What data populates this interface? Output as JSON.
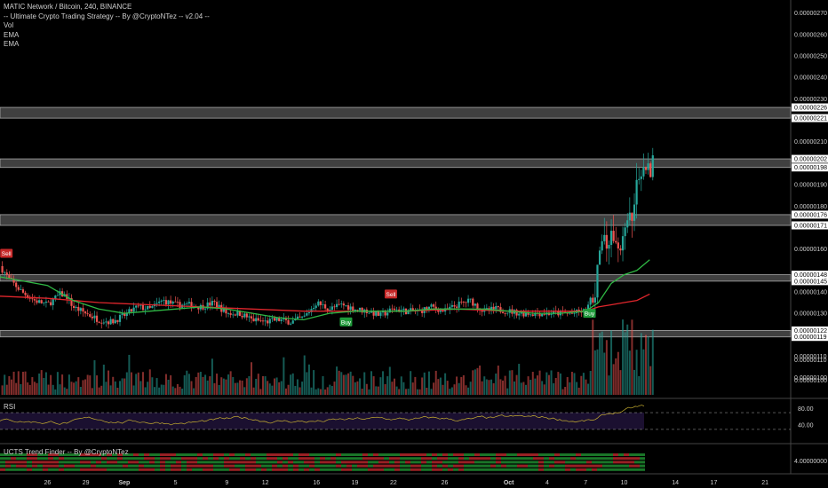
{
  "legend": {
    "symbol": "MATIC Network / Bitcoin, 240, BINANCE",
    "strategy": "-- Ultimate Crypto Trading Strategy -- By @CryptoNTez -- v2.04 --",
    "vol": "Vol",
    "ema1": "EMA",
    "ema2": "EMA"
  },
  "rsi_label": "RSI",
  "trend_label": "UCTS Trend Finder -- By @CryptoNTez",
  "colors": {
    "background": "#000000",
    "up": "#26a69a",
    "down": "#ef5350",
    "ema_fast": "#2fb844",
    "ema_slow": "#e0262c",
    "rsi_line": "#c8b030",
    "rsi_band": "#1b1030",
    "zone_fill": "#555555",
    "buy_label": "#1f9b3a",
    "sell_label": "#c62828"
  },
  "chart_data": {
    "type": "candlestick",
    "title": "MATIC Network / Bitcoin, 240, BINANCE",
    "price_ticks": [
      "0.00000270",
      "0.00000260",
      "0.00000250",
      "0.00000240",
      "0.00000230",
      "0.00000210",
      "0.00000190",
      "0.00000180",
      "0.00000160",
      "0.00000140",
      "0.00000130",
      "0.00000110",
      "0.00000100"
    ],
    "price_level_labels": [
      "0.00000226",
      "0.00000221",
      "0.00000202",
      "0.00000198",
      "0.00000176",
      "0.00000171",
      "0.00000148",
      "0.00000145",
      "0.00000122",
      "0.00000119"
    ],
    "y_range": [
      9.2e-07,
      2.74e-06
    ],
    "x_ticks": [
      "26",
      "29",
      "Sep",
      "5",
      "9",
      "12",
      "16",
      "19",
      "22",
      "26",
      "Oct",
      "4",
      "7",
      "10",
      "14",
      "17",
      "21"
    ],
    "x_tick_positions": [
      0,
      3,
      6,
      10,
      14,
      17,
      21,
      24,
      27,
      31,
      36,
      39,
      42,
      45,
      49,
      52,
      56
    ],
    "x_range": [
      -3.7,
      58
    ],
    "zones": [
      [
        2.21e-06,
        2.26e-06
      ],
      [
        1.98e-06,
        2.02e-06
      ],
      [
        1.71e-06,
        1.76e-06
      ],
      [
        1.45e-06,
        1.48e-06
      ],
      [
        1.19e-06,
        1.22e-06
      ]
    ],
    "close_path": [
      [
        -3.7,
        1.52
      ],
      [
        -3,
        1.46
      ],
      [
        -2,
        1.4
      ],
      [
        -1,
        1.36
      ],
      [
        0,
        1.34
      ],
      [
        1,
        1.39
      ],
      [
        1.5,
        1.38
      ],
      [
        2,
        1.33
      ],
      [
        3,
        1.3
      ],
      [
        4,
        1.27
      ],
      [
        5,
        1.26
      ],
      [
        6,
        1.29
      ],
      [
        7,
        1.33
      ],
      [
        8,
        1.32
      ],
      [
        9,
        1.36
      ],
      [
        10,
        1.34
      ],
      [
        11,
        1.34
      ],
      [
        12,
        1.33
      ],
      [
        13,
        1.35
      ],
      [
        14,
        1.3
      ],
      [
        15,
        1.3
      ],
      [
        16,
        1.27
      ],
      [
        17,
        1.26
      ],
      [
        18,
        1.27
      ],
      [
        19,
        1.26
      ],
      [
        20,
        1.28
      ],
      [
        21,
        1.35
      ],
      [
        22,
        1.32
      ],
      [
        23,
        1.34
      ],
      [
        24,
        1.32
      ],
      [
        25,
        1.31
      ],
      [
        26,
        1.29
      ],
      [
        27,
        1.32
      ],
      [
        28,
        1.31
      ],
      [
        29,
        1.31
      ],
      [
        30,
        1.33
      ],
      [
        31,
        1.31
      ],
      [
        32,
        1.34
      ],
      [
        33,
        1.36
      ],
      [
        34,
        1.31
      ],
      [
        35,
        1.32
      ],
      [
        36,
        1.31
      ],
      [
        37,
        1.3
      ],
      [
        38,
        1.3
      ],
      [
        39,
        1.3
      ],
      [
        40,
        1.3
      ],
      [
        41,
        1.3
      ],
      [
        42,
        1.31
      ],
      [
        42.7,
        1.4
      ],
      [
        43,
        1.56
      ],
      [
        43.5,
        1.62
      ],
      [
        44,
        1.66
      ],
      [
        44.5,
        1.6
      ],
      [
        45,
        1.66
      ],
      [
        45.5,
        1.74
      ],
      [
        46,
        1.88
      ],
      [
        46.5,
        2.03
      ],
      [
        47,
        1.96
      ],
      [
        47.3,
        2.04
      ]
    ],
    "ema_fast": [
      [
        -3.7,
        1.47
      ],
      [
        0,
        1.43
      ],
      [
        2,
        1.36
      ],
      [
        4,
        1.32
      ],
      [
        6,
        1.3
      ],
      [
        8,
        1.31
      ],
      [
        10,
        1.32
      ],
      [
        12,
        1.33
      ],
      [
        14,
        1.32
      ],
      [
        16,
        1.3
      ],
      [
        18,
        1.28
      ],
      [
        20,
        1.27
      ],
      [
        22,
        1.3
      ],
      [
        24,
        1.31
      ],
      [
        26,
        1.31
      ],
      [
        28,
        1.31
      ],
      [
        30,
        1.32
      ],
      [
        32,
        1.32
      ],
      [
        34,
        1.32
      ],
      [
        36,
        1.31
      ],
      [
        38,
        1.3
      ],
      [
        40,
        1.3
      ],
      [
        42,
        1.31
      ],
      [
        43,
        1.35
      ],
      [
        44,
        1.44
      ],
      [
        45,
        1.48
      ],
      [
        46,
        1.5
      ],
      [
        47,
        1.55
      ]
    ],
    "ema_slow": [
      [
        -3.7,
        1.38
      ],
      [
        0,
        1.37
      ],
      [
        4,
        1.35
      ],
      [
        8,
        1.34
      ],
      [
        12,
        1.33
      ],
      [
        16,
        1.32
      ],
      [
        20,
        1.31
      ],
      [
        24,
        1.31
      ],
      [
        28,
        1.31
      ],
      [
        32,
        1.32
      ],
      [
        36,
        1.31
      ],
      [
        40,
        1.31
      ],
      [
        42,
        1.31
      ],
      [
        43,
        1.33
      ],
      [
        44,
        1.34
      ],
      [
        45,
        1.35
      ],
      [
        46,
        1.36
      ],
      [
        47,
        1.39
      ]
    ],
    "signals": [
      {
        "label": "Sell",
        "x": -3.2,
        "price": 1.58,
        "type": "sell"
      },
      {
        "label": "Buy",
        "x": 23.3,
        "price": 1.26,
        "type": "buy"
      },
      {
        "label": "Sell",
        "x": 26.8,
        "price": 1.39,
        "type": "sell"
      },
      {
        "label": "Buy",
        "x": 42.3,
        "price": 1.3,
        "type": "buy"
      }
    ],
    "volume_ticks": [
      "0.00000110",
      "0.00000100"
    ],
    "rsi": {
      "ticks": [
        "80.00",
        "40.00"
      ],
      "upper": 70,
      "lower": 30
    },
    "trend_finder": {
      "tick": "4.00000000"
    }
  }
}
